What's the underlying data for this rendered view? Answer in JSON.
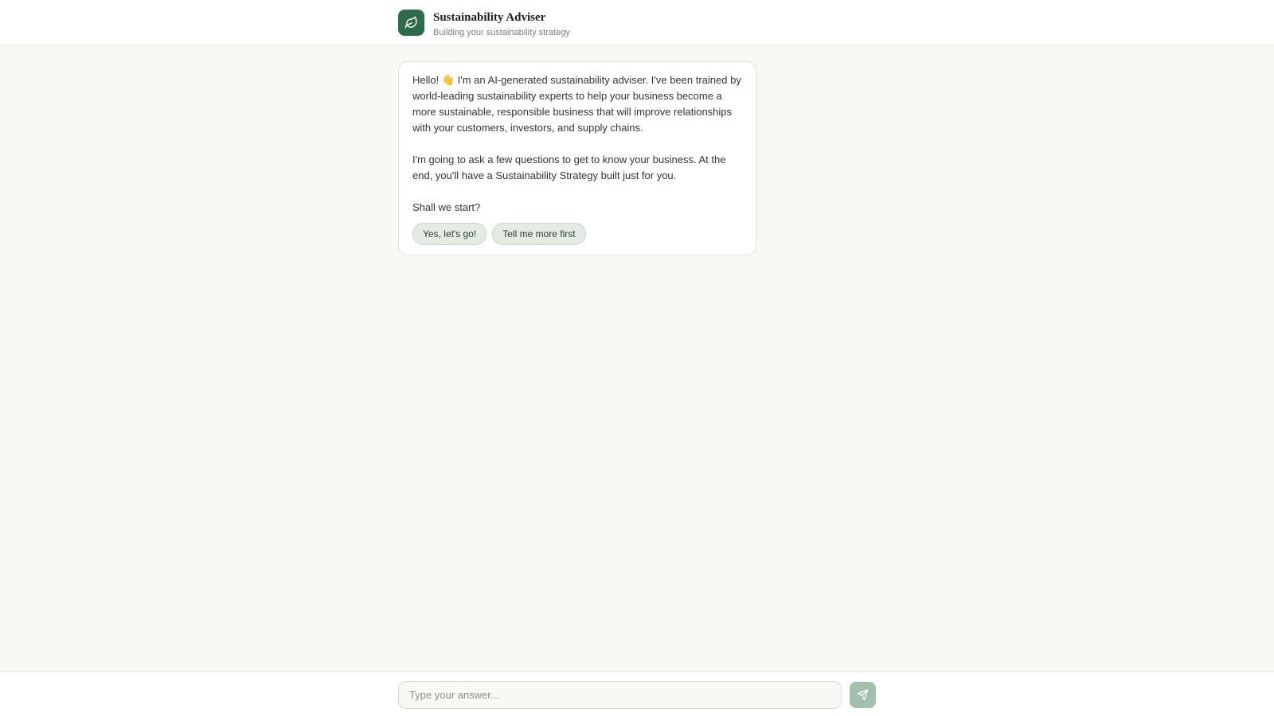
{
  "header": {
    "logo_icon": "leaf-icon",
    "title": "Sustainability Adviser",
    "subtitle": "Building your sustainability strategy"
  },
  "message": {
    "paragraphs": [
      "Hello! 👋 I'm an AI-generated sustainability adviser. I've been trained by world-leading sustainability experts to help your business become a more sustainable, responsible business that will improve relationships with your customers, investors, and supply chains.",
      "I'm going to ask a few questions to get to know your business. At the end, you'll have a Sustainability Strategy built just for you.",
      "Shall we start?"
    ],
    "choices": [
      "Yes, let's go!",
      "Tell me more first"
    ]
  },
  "composer": {
    "input_value": "",
    "input_placeholder": "Type your answer...",
    "send_icon": "send-icon"
  },
  "colors": {
    "brand": "#2f6b4a",
    "send_button": "#a3bfad",
    "chip_background": "#e3ebe4",
    "page_background": "#f9f8f5"
  }
}
